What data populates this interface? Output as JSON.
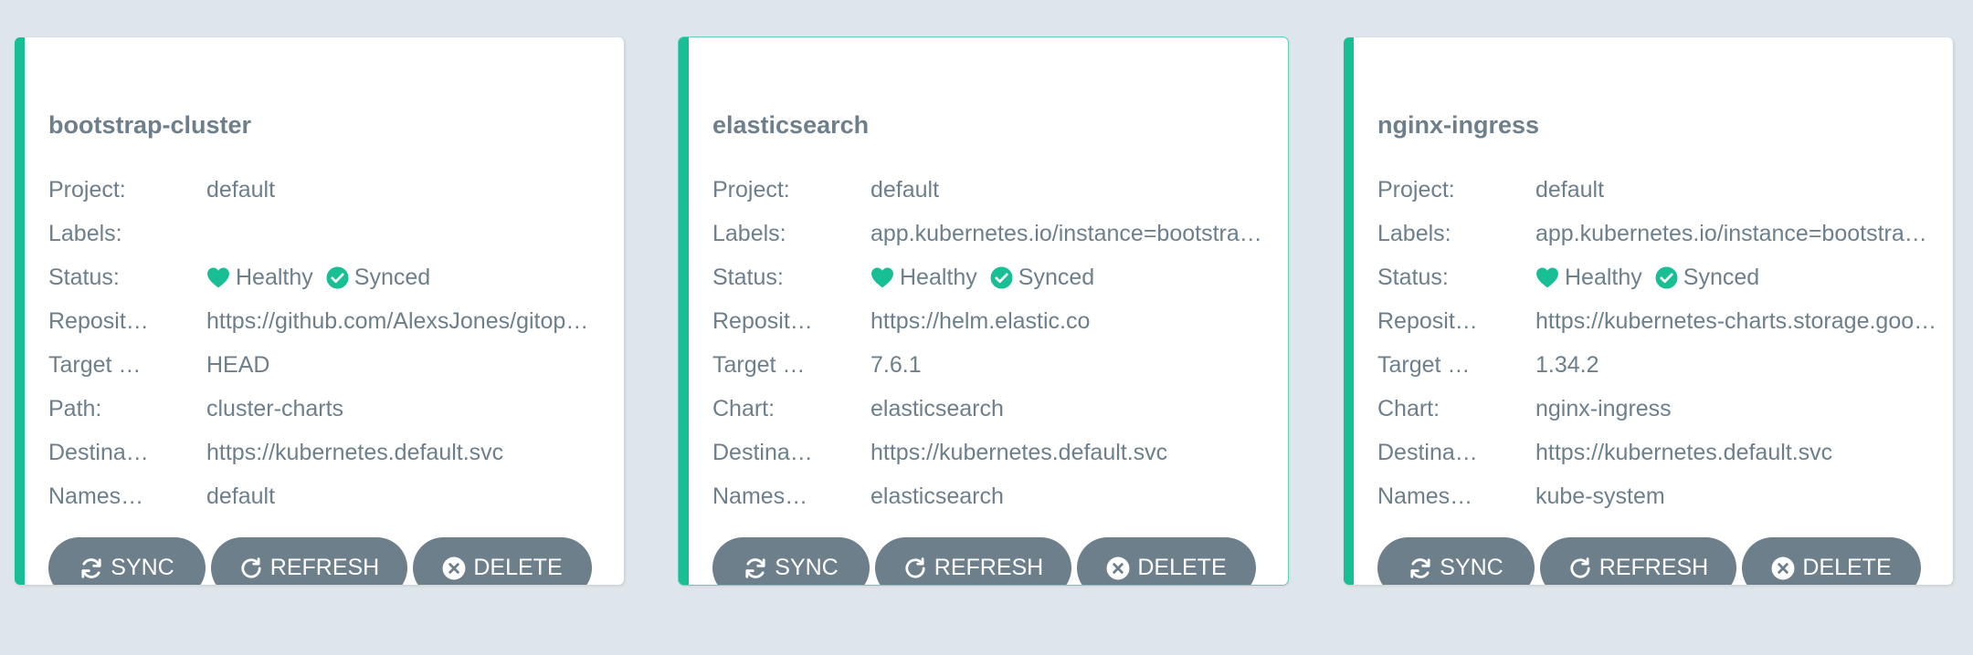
{
  "colors": {
    "background": "#dee6eb",
    "accent": "#18be94",
    "button": "#6d7f8b",
    "text": "#6d7f8b"
  },
  "apps": [
    {
      "name": "bootstrap-cluster",
      "selected": false,
      "rows": {
        "project": {
          "label": "Project:",
          "value": "default"
        },
        "labels": {
          "label": "Labels:",
          "value": ""
        },
        "status": {
          "label": "Status:",
          "health": "Healthy",
          "sync": "Synced"
        },
        "repository": {
          "label": "Reposit…",
          "value": "https://github.com/AlexsJones/gitop…"
        },
        "target": {
          "label": "Target …",
          "value": "HEAD"
        },
        "path_or_chart": {
          "label": "Path:",
          "value": "cluster-charts"
        },
        "destination": {
          "label": "Destina…",
          "value": "https://kubernetes.default.svc"
        },
        "namespace": {
          "label": "Names…",
          "value": "default"
        }
      },
      "buttons": {
        "sync": "SYNC",
        "refresh": "REFRESH",
        "delete": "DELETE"
      }
    },
    {
      "name": "elasticsearch",
      "selected": true,
      "rows": {
        "project": {
          "label": "Project:",
          "value": "default"
        },
        "labels": {
          "label": "Labels:",
          "value": "app.kubernetes.io/instance=bootstra…"
        },
        "status": {
          "label": "Status:",
          "health": "Healthy",
          "sync": "Synced"
        },
        "repository": {
          "label": "Reposit…",
          "value": "https://helm.elastic.co"
        },
        "target": {
          "label": "Target …",
          "value": "7.6.1"
        },
        "path_or_chart": {
          "label": "Chart:",
          "value": "elasticsearch"
        },
        "destination": {
          "label": "Destina…",
          "value": "https://kubernetes.default.svc"
        },
        "namespace": {
          "label": "Names…",
          "value": "elasticsearch"
        }
      },
      "buttons": {
        "sync": "SYNC",
        "refresh": "REFRESH",
        "delete": "DELETE"
      }
    },
    {
      "name": "nginx-ingress",
      "selected": false,
      "rows": {
        "project": {
          "label": "Project:",
          "value": "default"
        },
        "labels": {
          "label": "Labels:",
          "value": "app.kubernetes.io/instance=bootstra…"
        },
        "status": {
          "label": "Status:",
          "health": "Healthy",
          "sync": "Synced"
        },
        "repository": {
          "label": "Reposit…",
          "value": "https://kubernetes-charts.storage.goo…"
        },
        "target": {
          "label": "Target …",
          "value": "1.34.2"
        },
        "path_or_chart": {
          "label": "Chart:",
          "value": "nginx-ingress"
        },
        "destination": {
          "label": "Destina…",
          "value": "https://kubernetes.default.svc"
        },
        "namespace": {
          "label": "Names…",
          "value": "kube-system"
        }
      },
      "buttons": {
        "sync": "SYNC",
        "refresh": "REFRESH",
        "delete": "DELETE"
      }
    }
  ],
  "icons": {
    "health": "heart-icon",
    "sync_status": "check-circle-icon",
    "sync_button": "sync-arrows-icon",
    "refresh_button": "refresh-arrow-icon",
    "delete_button": "x-circle-icon"
  }
}
